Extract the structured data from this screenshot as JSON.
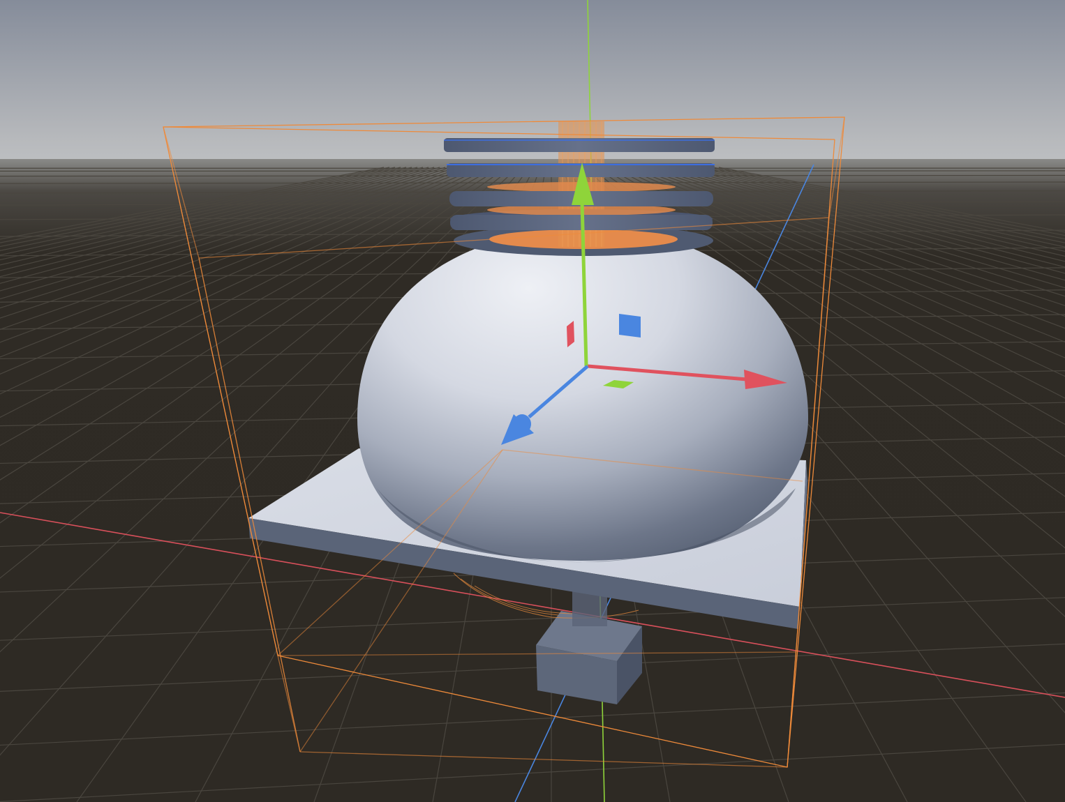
{
  "viewport": {
    "kind": "3d-editor-viewport",
    "projection": "perspective",
    "grid_visible": true
  },
  "colors": {
    "sky_top": "#878e9c",
    "horizon": "#bcbec1",
    "ground": "#2e2a24",
    "grid_line": "#4b4741",
    "axis_x": "#e0525e",
    "axis_y": "#8fd43a",
    "axis_z": "#4a86e0",
    "selection": "#ee8a3a",
    "mesh_light": "#d7dbe4",
    "mesh_dark": "#5b6577",
    "ring_dark": "#505b72",
    "ring_core": "#e08a4e"
  },
  "scene": {
    "objects": [
      {
        "name": "dome",
        "selected": true
      },
      {
        "name": "base-plate",
        "selected": false
      },
      {
        "name": "fin-rings",
        "selected": true
      },
      {
        "name": "lower-block",
        "selected": false
      }
    ]
  },
  "gizmo": {
    "mode": "translate",
    "handles": [
      "x",
      "y",
      "z"
    ],
    "plane_handles": [
      "xy",
      "yz",
      "xz"
    ]
  }
}
